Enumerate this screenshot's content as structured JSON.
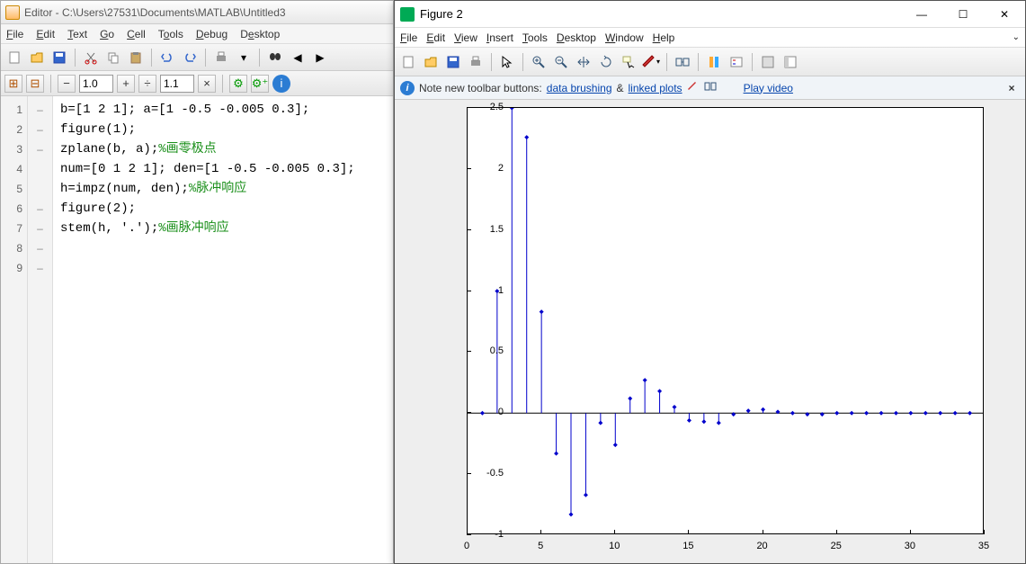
{
  "editor": {
    "title": "Editor - C:\\Users\\27531\\Documents\\MATLAB\\Untitled3",
    "menus": [
      "File",
      "Edit",
      "Text",
      "Go",
      "Cell",
      "Tools",
      "Debug",
      "Desktop"
    ],
    "zoom1": "1.0",
    "zoom2": "1.1",
    "code_lines": [
      {
        "n": "1",
        "brk": "–",
        "code": "b=[1 2 1]; a=[1 -0.5 -0.005 0.3];"
      },
      {
        "n": "2",
        "brk": "–",
        "code": "figure(1);"
      },
      {
        "n": "3",
        "brk": "–",
        "code": "zplane(b, a);",
        "comment": "%画零极点"
      },
      {
        "n": "4",
        "brk": "",
        "code": ""
      },
      {
        "n": "5",
        "brk": "",
        "code": ""
      },
      {
        "n": "6",
        "brk": "–",
        "code": "num=[0 1 2 1]; den=[1 -0.5 -0.005 0.3];"
      },
      {
        "n": "7",
        "brk": "–",
        "code": "h=impz(num, den);",
        "comment": "%脉冲响应"
      },
      {
        "n": "8",
        "brk": "–",
        "code": "figure(2);"
      },
      {
        "n": "9",
        "brk": "–",
        "code": "stem(h, '.');",
        "comment": "%画脉冲响应"
      }
    ]
  },
  "figure": {
    "title": "Figure 2",
    "menus": [
      "File",
      "Edit",
      "View",
      "Insert",
      "Tools",
      "Desktop",
      "Window",
      "Help"
    ],
    "note_prefix": "Note new toolbar buttons: ",
    "link1": "data brushing",
    "amp": " & ",
    "link2": "linked plots",
    "play": "Play video"
  },
  "chart_data": {
    "type": "stem",
    "x": [
      1,
      2,
      3,
      4,
      5,
      6,
      7,
      8,
      9,
      10,
      11,
      12,
      13,
      14,
      15,
      16,
      17,
      18,
      19,
      20,
      21,
      22,
      23,
      24,
      25,
      26,
      27,
      28,
      29,
      30,
      31,
      32,
      33,
      34
    ],
    "values": [
      0,
      1.0,
      2.5,
      2.26,
      0.83,
      -0.33,
      -0.83,
      -0.67,
      -0.08,
      -0.26,
      0.12,
      0.27,
      0.18,
      0.05,
      -0.06,
      -0.07,
      -0.08,
      -0.01,
      0.02,
      0.03,
      0.01,
      0.0,
      -0.01,
      -0.01,
      0.0,
      0.0,
      0.0,
      0.0,
      0.0,
      0.0,
      0.0,
      0.0,
      0.0,
      0.0
    ],
    "xlim": [
      0,
      35
    ],
    "ylim": [
      -1,
      2.5
    ],
    "xticks": [
      0,
      5,
      10,
      15,
      20,
      25,
      30,
      35
    ],
    "yticks": [
      -1,
      -0.5,
      0,
      0.5,
      1,
      1.5,
      2,
      2.5
    ]
  }
}
